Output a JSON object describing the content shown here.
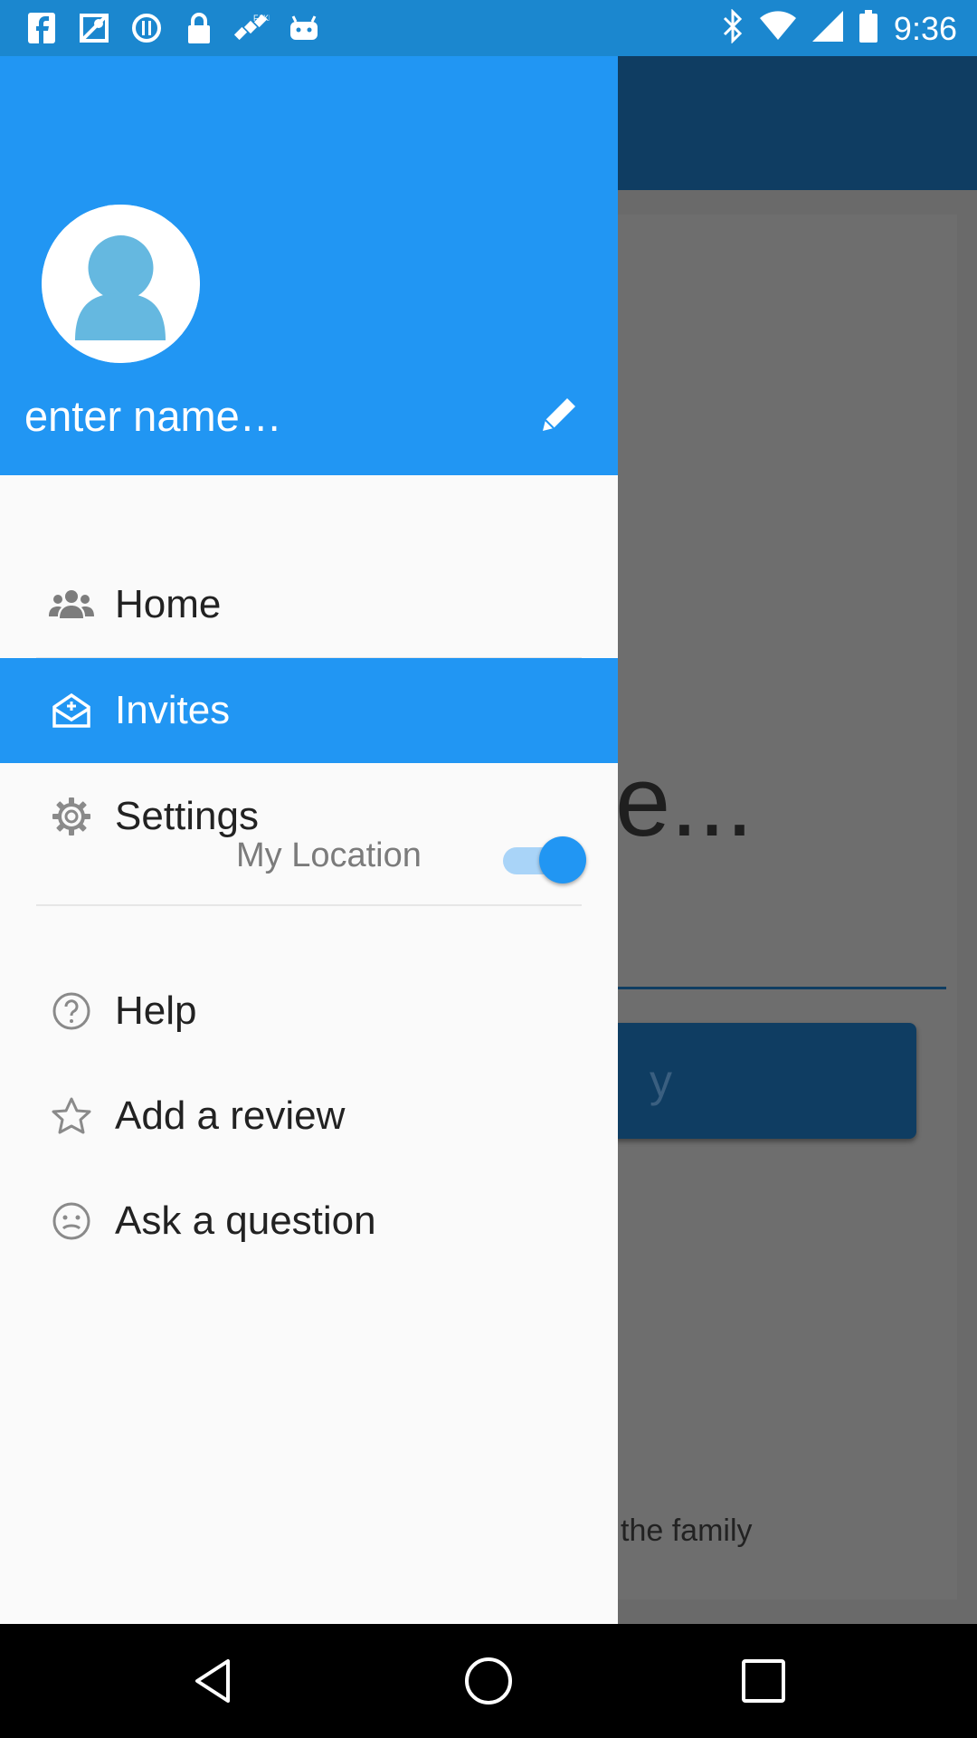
{
  "status_bar": {
    "time": "9:36",
    "left_icons": [
      "fb-icon",
      "maps-icon",
      "circle-status-icon",
      "lock-icon",
      "satellite-icon",
      "android-icon"
    ],
    "right_icons": [
      "bluetooth-icon",
      "wifi-icon",
      "signal-icon",
      "battery-icon"
    ]
  },
  "drawer": {
    "header": {
      "name_placeholder": "enter name…",
      "avatar_icon": "person-icon",
      "edit_icon": "pencil-icon"
    },
    "menu": [
      {
        "label": "Home",
        "icon": "group-icon",
        "active": false
      },
      {
        "label": "Invites",
        "icon": "open-mail-icon",
        "active": true
      },
      {
        "label": "Settings",
        "icon": "gear-icon",
        "active": false
      },
      {
        "label": "Help",
        "icon": "help-circle-icon",
        "active": false
      },
      {
        "label": "Add a review",
        "icon": "star-icon",
        "active": false
      },
      {
        "label": "Ask a question",
        "icon": "face-icon",
        "active": false
      }
    ],
    "location": {
      "label": "My Location",
      "enabled": true
    }
  },
  "background": {
    "title_fragment": "e...",
    "button_fragment": "y",
    "footer_fragment": "the family"
  },
  "colors": {
    "accent": "#2196f3",
    "appbar_dark": "#0f3d62",
    "statusbar": "#1b87cf"
  },
  "nav_bar": {
    "icons": [
      "back-icon",
      "home-icon",
      "recents-icon"
    ]
  }
}
